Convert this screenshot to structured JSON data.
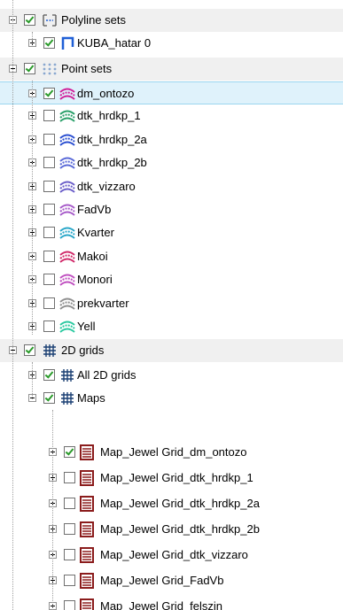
{
  "tree": {
    "categories": {
      "polyline": {
        "label": "Polyline sets",
        "icon": "polyline-sets-icon",
        "checked": true
      },
      "point": {
        "label": "Point sets",
        "icon": "point-sets-icon",
        "checked": true
      },
      "grids": {
        "label": "2D grids",
        "icon": "grid-icon",
        "checked": true
      }
    },
    "polyline_items": [
      {
        "label": "KUBA_hatar 0",
        "icon": "polyline-icon",
        "color": "#1f5fd6",
        "checked": true
      }
    ],
    "point_items": [
      {
        "label": "dm_ontozo",
        "icon": "point-set-icon",
        "color": "#d1209a",
        "checked": true,
        "selected": true
      },
      {
        "label": "dtk_hrdkp_1",
        "icon": "point-set-icon",
        "color": "#2aa06a",
        "checked": false
      },
      {
        "label": "dtk_hrdkp_2a",
        "icon": "point-set-icon",
        "color": "#2b4fd1",
        "checked": false
      },
      {
        "label": "dtk_hrdkp_2b",
        "icon": "point-set-icon",
        "color": "#5a6ad8",
        "checked": false
      },
      {
        "label": "dtk_vizzaro",
        "icon": "point-set-icon",
        "color": "#6b5ec9",
        "checked": false
      },
      {
        "label": "FadVb",
        "icon": "point-set-icon",
        "color": "#a75bc9",
        "checked": false
      },
      {
        "label": "Kvarter",
        "icon": "point-set-icon",
        "color": "#2aa7c9",
        "checked": false
      },
      {
        "label": "Makoi",
        "icon": "point-set-icon",
        "color": "#d12a6a",
        "checked": false
      },
      {
        "label": "Monori",
        "icon": "point-set-icon",
        "color": "#c050c0",
        "checked": false
      },
      {
        "label": "prekvarter",
        "icon": "point-set-icon",
        "color": "#909090",
        "checked": false
      },
      {
        "label": "Yell",
        "icon": "point-set-icon",
        "color": "#2ac9a0",
        "checked": false
      }
    ],
    "grid_folders": [
      {
        "label": "All 2D grids",
        "icon": "grid-folder-icon",
        "checked": true
      },
      {
        "label": "Maps",
        "icon": "grid-folder-icon",
        "checked": true
      }
    ],
    "map_items": [
      {
        "label": "Map_Jewel Grid_dm_ontozo",
        "icon": "grid-map-icon",
        "checked": true
      },
      {
        "label": "Map_Jewel Grid_dtk_hrdkp_1",
        "icon": "grid-map-icon",
        "checked": false
      },
      {
        "label": "Map_Jewel Grid_dtk_hrdkp_2a",
        "icon": "grid-map-icon",
        "checked": false
      },
      {
        "label": "Map_Jewel Grid_dtk_hrdkp_2b",
        "icon": "grid-map-icon",
        "checked": false
      },
      {
        "label": "Map_Jewel Grid_dtk_vizzaro",
        "icon": "grid-map-icon",
        "checked": false
      },
      {
        "label": "Map_Jewel Grid_FadVb",
        "icon": "grid-map-icon",
        "checked": false
      },
      {
        "label": "Map_Jewel Grid_felszin",
        "icon": "grid-map-icon",
        "checked": false
      }
    ],
    "colors": {
      "grid_icon": "#1a3f73",
      "map_icon": "#8b1c1c",
      "check": "#2a9a2a",
      "selection": "#dff2fb"
    }
  }
}
